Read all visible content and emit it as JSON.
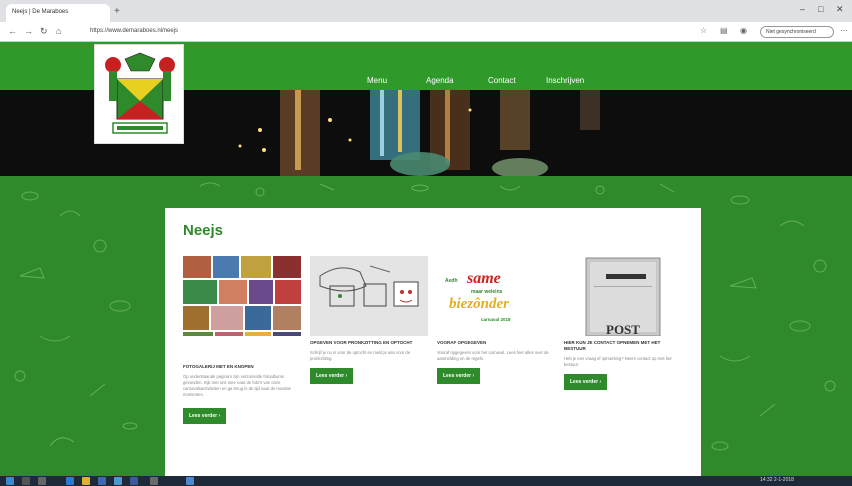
{
  "browser": {
    "tab_title": "Neejs | De Maraboes",
    "new_tab": "+",
    "url": "https://www.demaraboes.nl/neejs",
    "signin_label": "Niet gesynchroniseerd",
    "minimize": "–",
    "maximize": "□",
    "close": "✕"
  },
  "nav": {
    "items": [
      "Menu",
      "Agenda",
      "Contact",
      "Inschrijven"
    ]
  },
  "page": {
    "title": "Neejs",
    "items": [
      {
        "title": "Fotogalerij met en knopen",
        "text": "Op onderstaande pagina's zijn verzamelde fotoalbums gevonden. Kijk met ons mee naar de foto's van onze carnavalsactiviteiten en ga terug in de tijd naar de mooiste momenten.",
        "button": "Lees verder ›"
      },
      {
        "title": "Opgeven voor pronkzitting en optocht",
        "text": "Schrijf je nu in voor de optocht en meld je aan voor de pronkzitting.",
        "button": "Lees verder ›"
      },
      {
        "title": "Vooraf opgegeven",
        "text": "Vooraf opgegeven voor het carnaval. Lees hier alles over de aanmelding en de regels.",
        "button": "Lees verder ›"
      },
      {
        "title": "Hier kun je contact opnemen met het bestuur",
        "text": "Heb je een vraag of opmerking? Neem contact op met het bestuur.",
        "button": "Lees verder ›"
      }
    ],
    "banner": {
      "small": "Aedh",
      "big": "same",
      "line2": "maar weleins",
      "big2": "biezônder",
      "line3": "carnaval 2018"
    },
    "post_label": "POST"
  },
  "colors": {
    "brand_green": "#2e8a2a",
    "header_green": "#2f9a2a",
    "white": "#ffffff"
  },
  "taskbar": {
    "clock": "14:32 2-1-2018"
  }
}
